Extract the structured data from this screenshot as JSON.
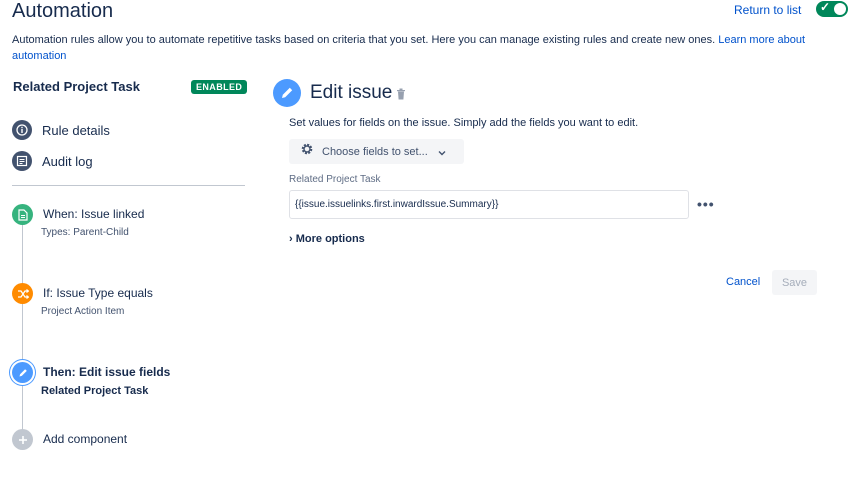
{
  "header": {
    "title": "Automation",
    "return_link": "Return to list",
    "toggle_state": "on"
  },
  "description": {
    "text": "Automation rules allow you to automate repetitive tasks based on criteria that you set. Here you can manage existing rules and create new ones.",
    "link": "Learn more about automation"
  },
  "rule": {
    "name": "Related Project Task",
    "status": "ENABLED",
    "status_color": "#00875a"
  },
  "nav": {
    "rule_details": "Rule details",
    "audit_log": "Audit log"
  },
  "components": {
    "trigger": {
      "title": "When: Issue linked",
      "sub": "Types: Parent-Child",
      "color": "#36b37e",
      "icon": "document-icon"
    },
    "condition": {
      "title": "If: Issue Type equals",
      "sub": "Project Action Item",
      "color": "#ff8b00",
      "icon": "shuffle-icon"
    },
    "action": {
      "title": "Then: Edit issue fields",
      "sub": "Related Project Task",
      "color": "#4c9aff",
      "icon": "pencil-icon"
    },
    "add": {
      "title": "Add component",
      "color": "#c1c7d0",
      "icon": "plus-icon"
    }
  },
  "editor": {
    "title": "Edit issue",
    "description": "Set values for fields on the issue. Simply add the fields you want to edit.",
    "choose_fields": "Choose fields to set...",
    "field_label": "Related Project Task",
    "field_value": "{{issue.issuelinks.first.inwardIssue.Summary}}",
    "more_options": "More options",
    "cancel": "Cancel",
    "save": "Save"
  }
}
